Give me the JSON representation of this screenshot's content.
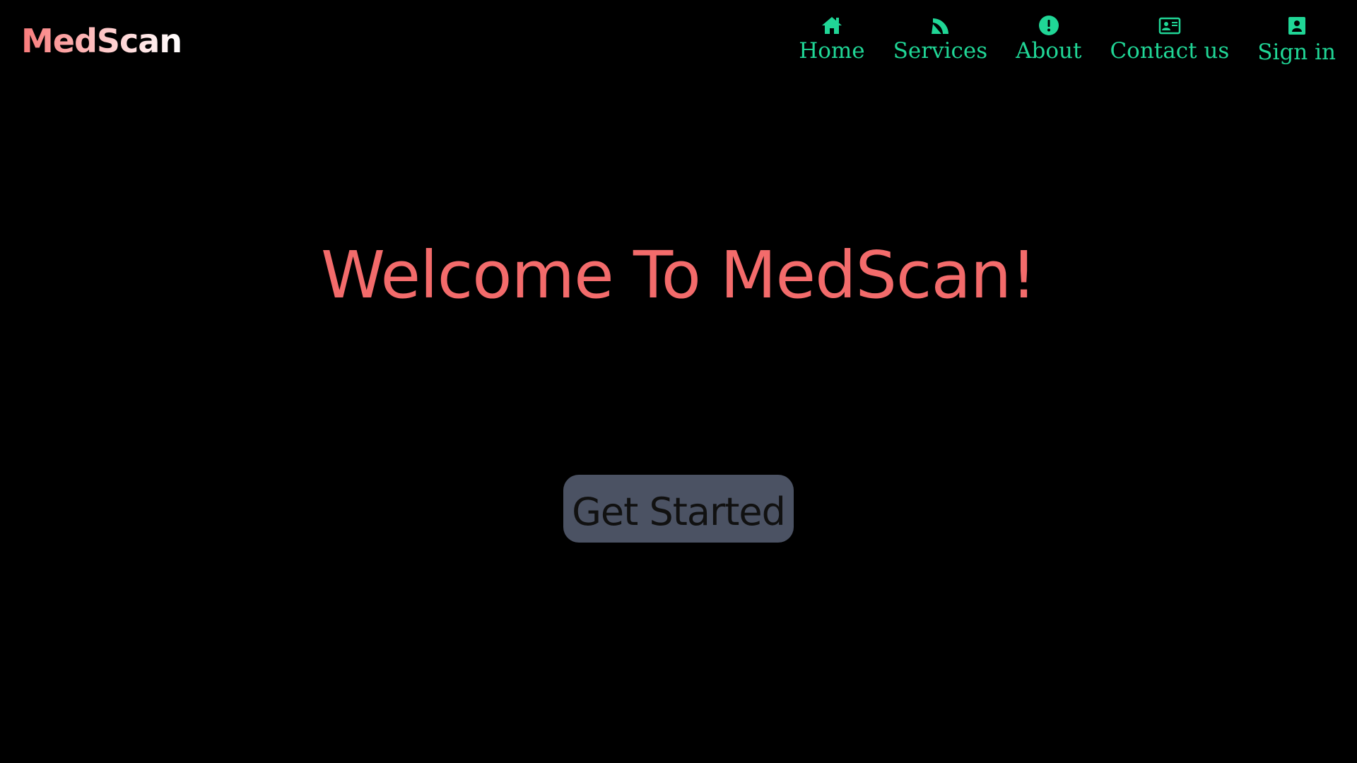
{
  "brand": {
    "name": "MedScan"
  },
  "nav": {
    "items": [
      {
        "label": "Home",
        "icon": "home-icon"
      },
      {
        "label": "Services",
        "icon": "satellite-dish-icon"
      },
      {
        "label": "About",
        "icon": "exclamation-circle-icon"
      },
      {
        "label": "Contact us",
        "icon": "id-card-icon"
      },
      {
        "label": "Sign in",
        "icon": "user-square-icon"
      }
    ]
  },
  "hero": {
    "title": "Welcome To MedScan!",
    "cta_label": "Get Started"
  },
  "colors": {
    "background": "#000000",
    "nav_accent": "#20d696",
    "hero_title": "#f36b6b",
    "button_bg": "#4b5263",
    "button_text": "#111111"
  }
}
